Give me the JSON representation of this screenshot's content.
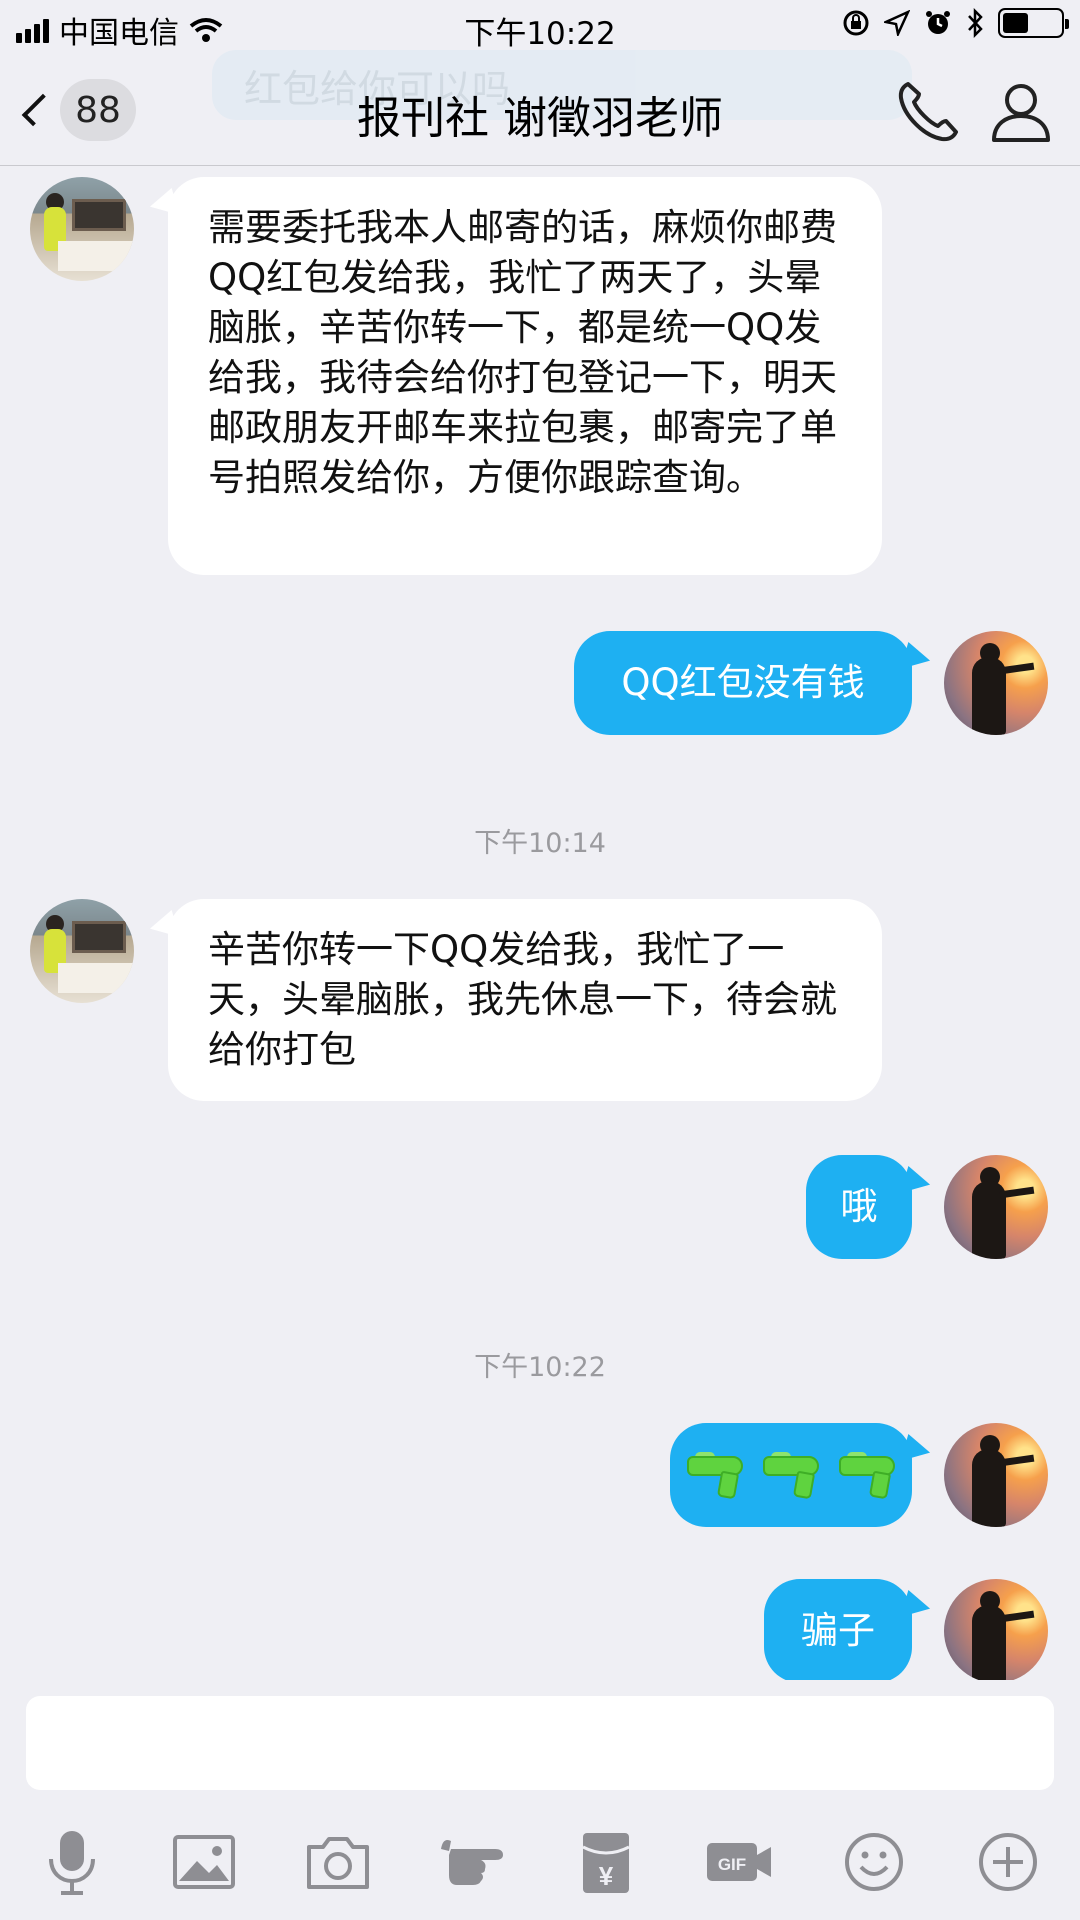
{
  "status_bar": {
    "carrier": "中国电信",
    "time": "下午10:22",
    "battery_level": 0.45
  },
  "nav": {
    "unread_count": "88",
    "title": "报刊社 谢徵羽老师",
    "ghost_text": "红包给你可以吗"
  },
  "messages": {
    "m1": "需要委托我本人邮寄的话，麻烦你邮费QQ红包发给我，我忙了两天了，头晕脑胀，辛苦你转一下，都是统一QQ发给我，我待会给你打包登记一下，明天邮政朋友开邮车来拉包裹，邮寄完了单号拍照发给你，方便你跟踪查询。",
    "m2": "QQ红包没有钱",
    "ts1": "下午10:14",
    "m3": "辛苦你转一下QQ发给我，我忙了一天，头晕脑胀，我先休息一下，待会就给你打包",
    "m4": "哦",
    "ts2": "下午10:22",
    "m5_emoji": "water-pistol x3",
    "m6": "骗子"
  },
  "input": {
    "value": ""
  },
  "toolbar": {
    "gif_label": "GIF",
    "hongbao_symbol": "¥"
  },
  "colors": {
    "outgoing_bubble": "#1eb0f2",
    "incoming_bubble": "#ffffff",
    "background": "#efeff4"
  }
}
